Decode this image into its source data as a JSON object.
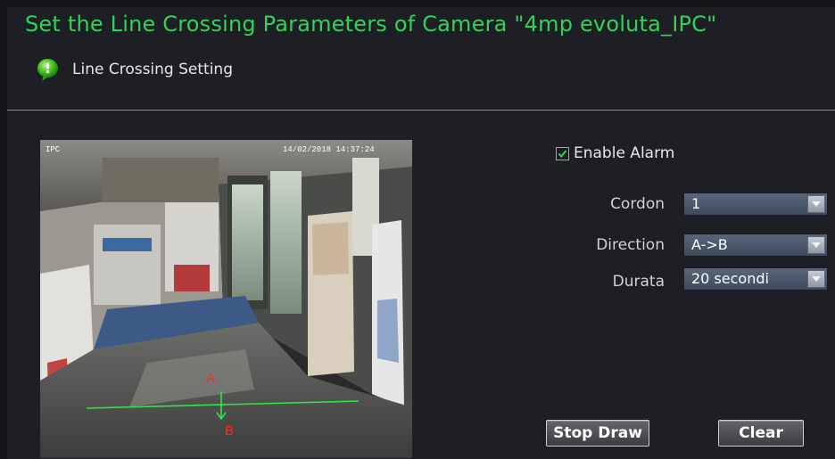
{
  "header": {
    "title": "Set the Line Crossing Parameters of Camera \"4mp evoluta_IPC\"",
    "section_label": "Line Crossing Setting",
    "title_color": "#2fd35a"
  },
  "preview": {
    "overlay_channel": "IPC",
    "overlay_timestamp": "14/02/2018 14:37:24",
    "point_a_label": "A",
    "point_b_label": "B",
    "line_color": "#2ee34b",
    "label_color": "#ff2a2a"
  },
  "settings": {
    "enable_alarm_label": "Enable Alarm",
    "enable_alarm_checked": true,
    "cordon": {
      "label": "Cordon",
      "value": "1"
    },
    "direction": {
      "label": "Direction",
      "value": "A->B"
    },
    "durata": {
      "label": "Durata",
      "value": "20 secondi"
    }
  },
  "buttons": {
    "stop_draw": "Stop Draw",
    "clear": "Clear"
  },
  "icons": {
    "section": "speech-bubble-icon",
    "dropdown": "chevron-down-icon",
    "check": "check-icon"
  }
}
